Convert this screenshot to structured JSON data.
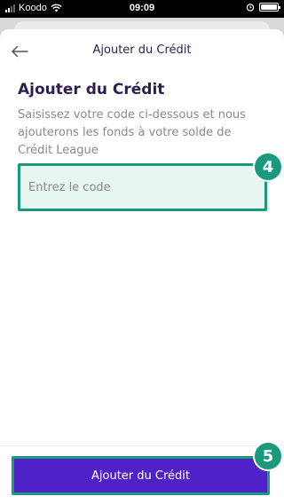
{
  "status_bar": {
    "carrier": "Koodo",
    "time": "09:09"
  },
  "header": {
    "back_icon": "arrow-left-icon",
    "title": "Ajouter du Crédit"
  },
  "main": {
    "heading": "Ajouter du Crédit",
    "description": "Saisissez votre code ci-dessous et nous ajouterons les fonds à votre solde de Crédit League",
    "code_input": {
      "placeholder": "Entrez le code",
      "value": ""
    }
  },
  "footer": {
    "submit_label": "Ajouter du Crédit"
  },
  "annotations": {
    "step_4": "4",
    "step_5": "5"
  },
  "colors": {
    "accent_purple": "#4f21c9",
    "highlight_green": "#1a9a7d",
    "input_bg": "#e8f6f2",
    "heading_text": "#2b1f4f"
  }
}
